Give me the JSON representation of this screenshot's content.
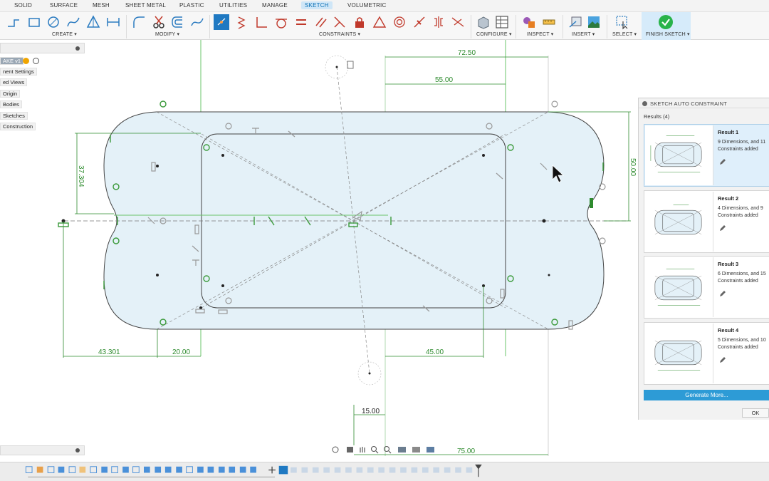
{
  "tabs": [
    "SOLID",
    "SURFACE",
    "MESH",
    "SHEET METAL",
    "PLASTIC",
    "UTILITIES",
    "MANAGE",
    "SKETCH",
    "VOLUMETRIC"
  ],
  "active_tab": "SKETCH",
  "groups": {
    "create": "CREATE ▾",
    "modify": "MODIFY ▾",
    "constraints": "CONSTRAINTS ▾",
    "configure": "CONFIGURE ▾",
    "inspect": "INSPECT ▾",
    "insert": "INSERT ▾",
    "select": "SELECT ▾",
    "finish": "FINISH SKETCH ▾"
  },
  "browser": {
    "doc_label": "AKE v1",
    "items": [
      "nent Settings",
      "ed Views",
      "Origin",
      "Bodies",
      "Sketches",
      "Construction"
    ]
  },
  "dimensions": {
    "d1": "72.50",
    "d2": "55.00",
    "d3": "37.304",
    "d4": "50.00",
    "d5": "43.301",
    "d6": "20.00",
    "d7": "45.00",
    "d8": "15.00",
    "d9": "75.00"
  },
  "panel": {
    "title": "SKETCH AUTO CONSTRAINT",
    "results_label": "Results (4)",
    "results": [
      {
        "title": "Result 1",
        "desc": "9 Dimensions, and 11 Constraints added"
      },
      {
        "title": "Result 2",
        "desc": "4 Dimensions, and 9 Constraints added"
      },
      {
        "title": "Result 3",
        "desc": "6 Dimensions, and 15 Constraints added"
      },
      {
        "title": "Result 4",
        "desc": "5 Dimensions, and 10 Constraints added"
      }
    ],
    "generate_more": "Generate More...",
    "ok": "OK"
  },
  "colors": {
    "accent": "#0a6fb3",
    "dimension": "#2e8b2e",
    "sketch_fill": "#e4f1f8",
    "finish_green": "#29b34a",
    "primary_button": "#2d9bd6"
  }
}
